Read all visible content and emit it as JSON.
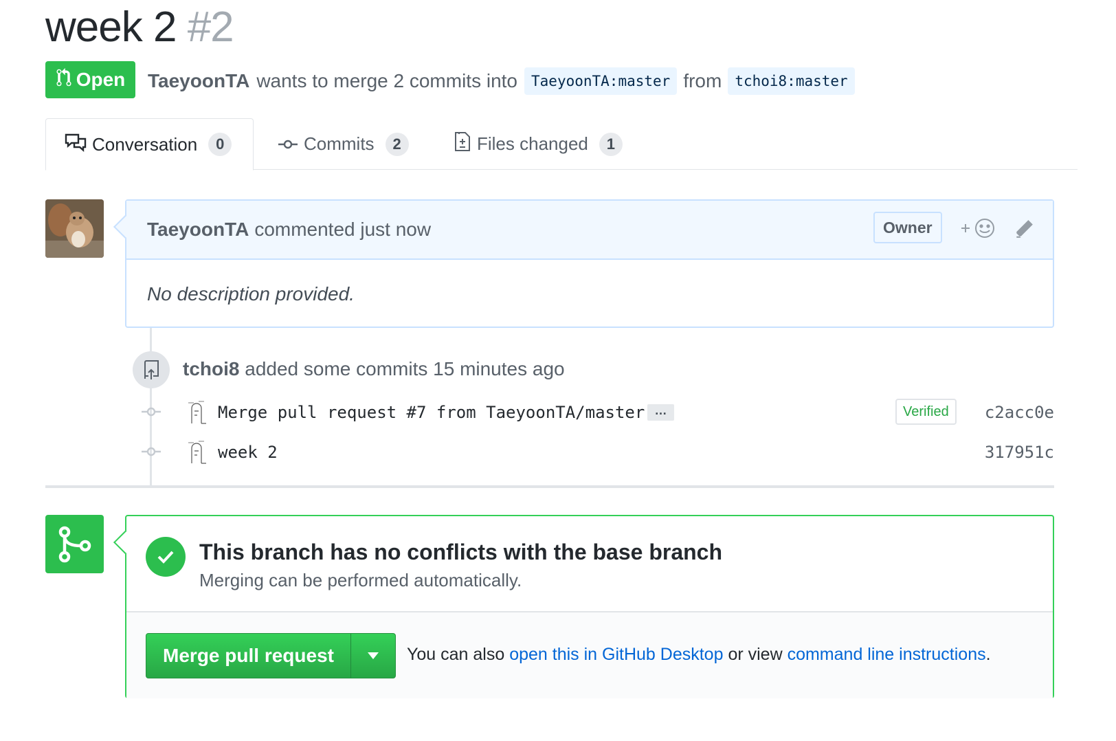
{
  "pr": {
    "title": "week 2",
    "number": "#2",
    "state": "Open",
    "author": "TaeyoonTA",
    "merge_text": "wants to merge 2 commits into",
    "base_branch": "TaeyoonTA:master",
    "from_text": "from",
    "head_branch": "tchoi8:master"
  },
  "tabs": [
    {
      "label": "Conversation",
      "count": "0"
    },
    {
      "label": "Commits",
      "count": "2"
    },
    {
      "label": "Files changed",
      "count": "1"
    }
  ],
  "comment": {
    "author": "TaeyoonTA",
    "action": "commented just now",
    "role": "Owner",
    "reaction_plus": "+",
    "body": "No description provided."
  },
  "timeline": {
    "actor": "tchoi8",
    "action": "added some commits 15 minutes ago",
    "commits": [
      {
        "message": "Merge pull request #7 from TaeyoonTA/master",
        "ellipsis": "…",
        "verified": "Verified",
        "sha": "c2acc0e"
      },
      {
        "message": "week 2",
        "sha": "317951c"
      }
    ]
  },
  "merge": {
    "heading": "This branch has no conflicts with the base branch",
    "sub": "Merging can be performed automatically.",
    "button_label": "Merge pull request",
    "also_text": "You can also",
    "desktop_link": "open this in GitHub Desktop",
    "or_view": "or view",
    "cli_link": "command line instructions",
    "period": "."
  },
  "colors": {
    "green": "#2cbe4e",
    "link": "#0366d6",
    "comment_border": "#c8e1ff"
  },
  "icons": [
    "git-pull-request-icon",
    "comment-discussion-icon",
    "git-commit-icon",
    "diff-icon",
    "smiley-icon",
    "pencil-icon",
    "repo-push-icon",
    "git-merge-icon",
    "check-icon",
    "triangle-down-icon"
  ]
}
